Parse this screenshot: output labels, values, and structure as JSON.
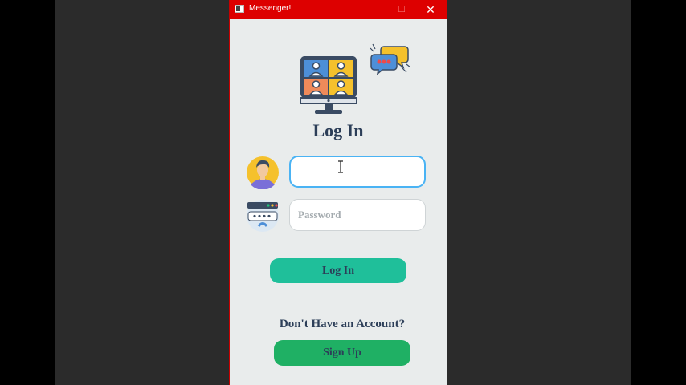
{
  "window": {
    "title": "Messenger!",
    "controls": {
      "minimize": "—",
      "maximize": "☐",
      "close": "✕"
    }
  },
  "icons": {
    "app": "messenger-app-icon",
    "illustration": "video-conference-computer-icon",
    "chat": "chat-bubbles-icon",
    "user": "user-avatar-icon",
    "password": "password-lock-icon",
    "cursor": "text-cursor-icon"
  },
  "form": {
    "heading": "Log In",
    "username": {
      "value": "",
      "placeholder": ""
    },
    "password": {
      "value": "",
      "placeholder": "Password"
    },
    "login_label": "Log In",
    "signup_prompt": "Don't Have an Account?",
    "signup_label": "Sign Up"
  },
  "colors": {
    "titlebar": "#dd0000",
    "window_bg": "#e9ecec",
    "heading_text": "#2c3e58",
    "login_button": "#1fbf9a",
    "signup_button": "#1fb064",
    "focus_border": "#4ab3f4"
  }
}
